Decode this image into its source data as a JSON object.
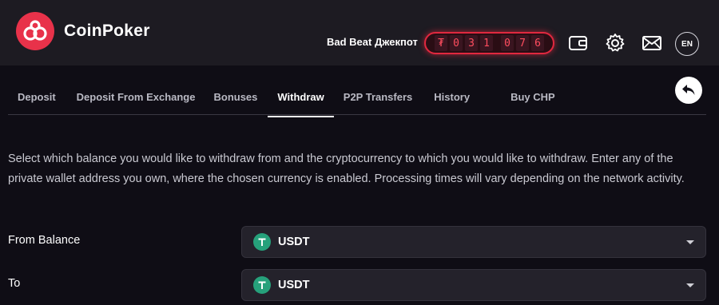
{
  "header": {
    "brand": "CoinPoker",
    "jackpot_label": "Bad Beat Джекпот",
    "jackpot_digits": [
      "₮",
      "0",
      "3",
      "1",
      "0",
      "7",
      "6"
    ],
    "language": "EN",
    "icons": [
      "wallet-icon",
      "gear-icon",
      "mail-icon"
    ]
  },
  "tabs": [
    {
      "label": "Deposit"
    },
    {
      "label": "Deposit From Exchange"
    },
    {
      "label": "Bonuses"
    },
    {
      "label": "Withdraw",
      "active": true
    },
    {
      "label": "P2P Transfers"
    },
    {
      "label": "History"
    },
    {
      "label": "Buy CHP"
    }
  ],
  "description": "Select which balance you would like to withdraw from and the cryptocurrency to which you would like to withdraw. Enter any of the private wallet address you own, where the chosen currency is enabled. Processing times will vary depending on the network activity.",
  "form": {
    "from_balance": {
      "label": "From Balance",
      "value": "USDT"
    },
    "to": {
      "label": "To",
      "value": "USDT"
    }
  },
  "colors": {
    "accent": "#e0283f",
    "tether": "#26a17b",
    "background": "#0f0d15",
    "topbar": "#1d1b22"
  }
}
